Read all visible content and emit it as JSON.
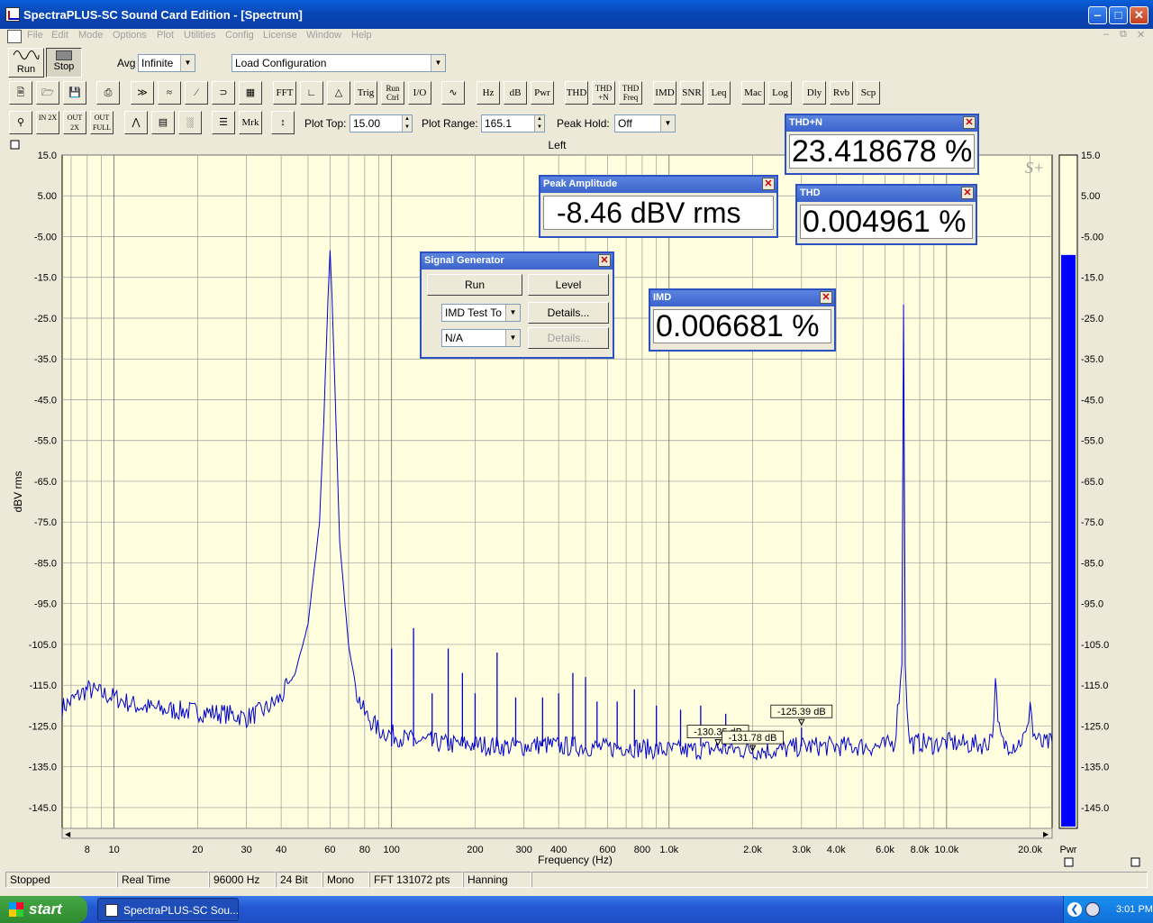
{
  "window": {
    "title": "SpectraPLUS-SC Sound Card Edition - [Spectrum]",
    "min": "‒",
    "max": "□",
    "close": "✕"
  },
  "menu": {
    "items": [
      "File",
      "Edit",
      "Mode",
      "Options",
      "Plot",
      "Utilities",
      "Config",
      "License",
      "Window",
      "Help"
    ]
  },
  "toolbar1": {
    "run": "Run",
    "stop": "Stop",
    "avg_label": "Avg",
    "avg_value": "Infinite",
    "load_config": "Load Configuration"
  },
  "toolbar2": {
    "buttons": [
      "FFT",
      "Trig",
      "Run Ctrl",
      "I/O",
      "Hz",
      "dB",
      "Pwr",
      "THD",
      "THD +N",
      "THD Freq",
      "IMD",
      "SNR",
      "Leq",
      "Mac",
      "Log",
      "Dly",
      "Rvb",
      "Scp"
    ]
  },
  "toolbar3": {
    "zoom_in": "IN 2X",
    "zoom_out": "OUT 2X",
    "zoom_full": "OUT FULL",
    "mrk": "Mrk",
    "plot_top_label": "Plot Top:",
    "plot_top_value": "15.00",
    "plot_range_label": "Plot Range:",
    "plot_range_value": "165.1",
    "peak_hold_label": "Peak Hold:",
    "peak_hold_value": "Off"
  },
  "chart_data": {
    "type": "line",
    "title": "Left",
    "xlabel": "Frequency (Hz)",
    "ylabel": "dBV rms",
    "xscale": "log",
    "xlim": [
      6.5,
      24000
    ],
    "ylim": [
      -150.1,
      15.0
    ],
    "grid": true,
    "yticks": [
      "15.0",
      "5.00",
      "-5.00",
      "-15.0",
      "-25.0",
      "-35.0",
      "-45.0",
      "-55.0",
      "-65.0",
      "-75.0",
      "-85.0",
      "-95.0",
      "-105.0",
      "-115.0",
      "-125.0",
      "-135.0",
      "-145.0"
    ],
    "ytick_values": [
      15,
      5,
      -5,
      -15,
      -25,
      -35,
      -45,
      -55,
      -65,
      -75,
      -85,
      -95,
      -105,
      -115,
      -125,
      -135,
      -145
    ],
    "xticks": [
      {
        "v": 8,
        "t": "8"
      },
      {
        "v": 10,
        "t": "10"
      },
      {
        "v": 20,
        "t": "20"
      },
      {
        "v": 30,
        "t": "30"
      },
      {
        "v": 40,
        "t": "40"
      },
      {
        "v": 60,
        "t": "60"
      },
      {
        "v": 80,
        "t": "80"
      },
      {
        "v": 100,
        "t": "100"
      },
      {
        "v": 200,
        "t": "200"
      },
      {
        "v": 300,
        "t": "300"
      },
      {
        "v": 400,
        "t": "400"
      },
      {
        "v": 600,
        "t": "600"
      },
      {
        "v": 800,
        "t": "800"
      },
      {
        "v": 1000,
        "t": "1.0k"
      },
      {
        "v": 2000,
        "t": "2.0k"
      },
      {
        "v": 3000,
        "t": "3.0k"
      },
      {
        "v": 4000,
        "t": "4.0k"
      },
      {
        "v": 6000,
        "t": "6.0k"
      },
      {
        "v": 8000,
        "t": "8.0k"
      },
      {
        "v": 10000,
        "t": "10.0k"
      },
      {
        "v": 20000,
        "t": "20.0k"
      }
    ],
    "series": [
      {
        "color": "#0000cc",
        "x": [
          6.5,
          8,
          10,
          12,
          15,
          20,
          25,
          28,
          30,
          35,
          40,
          45,
          50,
          55,
          57,
          59,
          60,
          61,
          63,
          65,
          70,
          75,
          80,
          90,
          100,
          110,
          120,
          140,
          160,
          200,
          250,
          300,
          350,
          400,
          500,
          600,
          700,
          800,
          1000,
          1200,
          1500,
          2000,
          2500,
          3000,
          3500,
          4000,
          5000,
          6000,
          6500,
          6900,
          7000,
          7100,
          7300,
          7600,
          8000,
          9000,
          10000,
          12000,
          14000,
          14800,
          15000,
          15300,
          16000,
          18000,
          19500,
          20000,
          20500,
          22000,
          24000
        ],
        "y": [
          -120.5,
          -116,
          -118,
          -120,
          -121,
          -121.5,
          -122,
          -122.5,
          -123,
          -121,
          -118,
          -112,
          -100,
          -75,
          -50,
          -20,
          -8.5,
          -20,
          -50,
          -80,
          -105,
          -117,
          -122,
          -126,
          -127,
          -128,
          -128.5,
          -129,
          -129.5,
          -129.5,
          -130,
          -130,
          -129.5,
          -130,
          -130,
          -130.5,
          -130,
          -130.5,
          -131,
          -131,
          -130.5,
          -131,
          -131,
          -130,
          -130,
          -130,
          -130,
          -130,
          -129,
          -110,
          -21.5,
          -110,
          -128,
          -129.5,
          -129,
          -129.5,
          -129,
          -129.5,
          -129.5,
          -125,
          -113,
          -125,
          -129.5,
          -129.5,
          -127,
          -118,
          -127,
          -129.5,
          -129
        ]
      }
    ],
    "spikes": [
      {
        "x": 100,
        "y": -106
      },
      {
        "x": 120,
        "y": -101
      },
      {
        "x": 140,
        "y": -117
      },
      {
        "x": 160,
        "y": -106
      },
      {
        "x": 180,
        "y": -112
      },
      {
        "x": 200,
        "y": -117
      },
      {
        "x": 240,
        "y": -107
      },
      {
        "x": 280,
        "y": -118
      },
      {
        "x": 350,
        "y": -118
      },
      {
        "x": 400,
        "y": -117
      },
      {
        "x": 450,
        "y": -112
      },
      {
        "x": 500,
        "y": -113
      },
      {
        "x": 550,
        "y": -119
      },
      {
        "x": 650,
        "y": -119
      },
      {
        "x": 750,
        "y": -116
      },
      {
        "x": 900,
        "y": -120
      },
      {
        "x": 1100,
        "y": -121
      },
      {
        "x": 1300,
        "y": -120
      },
      {
        "x": 1600,
        "y": -122
      },
      {
        "x": 3000,
        "y": -125.4
      },
      {
        "x": 1500,
        "y": -130.4
      },
      {
        "x": 2000,
        "y": -131.8
      }
    ],
    "markers": [
      {
        "x": 1500,
        "y": -130.35,
        "t": "-130.35 dB"
      },
      {
        "x": 2000,
        "y": -131.78,
        "t": "-131.78 dB"
      },
      {
        "x": 3000,
        "y": -125.39,
        "t": "-125.39 dB"
      }
    ],
    "meter": {
      "label": "Pwr",
      "level": -9.5,
      "ticks": [
        "15.0",
        "5.00",
        "-5.00",
        "-15.0",
        "-25.0",
        "-35.0",
        "-45.0",
        "-55.0",
        "-65.0",
        "-75.0",
        "-85.0",
        "-95.0",
        "-105.0",
        "-115.0",
        "-125.0",
        "-135.0",
        "-145.0"
      ]
    }
  },
  "windows": {
    "thdn": {
      "title": "THD+N",
      "value": "23.418678 %",
      "close": "✕"
    },
    "thd": {
      "title": "THD",
      "value": "0.004961 %",
      "close": "✕"
    },
    "peak": {
      "title": "Peak Amplitude",
      "value": "-8.46 dBV rms",
      "close": "✕"
    },
    "imd": {
      "title": "IMD",
      "value": "0.006681 %",
      "close": "✕"
    },
    "siggen": {
      "title": "Signal Generator",
      "run": "Run",
      "level": "Level",
      "type": "IMD Test To",
      "type2": "N/A",
      "details1": "Details...",
      "details2": "Details...",
      "close": "✕"
    }
  },
  "status": {
    "state": "Stopped",
    "mode": "Real Time",
    "rate": "96000 Hz",
    "bits": "24 Bit",
    "channels": "Mono",
    "fft": "FFT 131072 pts",
    "window": "Hanning"
  },
  "taskbar": {
    "start": "start",
    "item": "SpectraPLUS-SC Sou...",
    "clock": "3:01 PM"
  },
  "colors": {
    "plot_bg": "#ffffe0",
    "trace": "#0000cc",
    "meter": "#0000ff",
    "title_bar": "#0a5fd8"
  }
}
